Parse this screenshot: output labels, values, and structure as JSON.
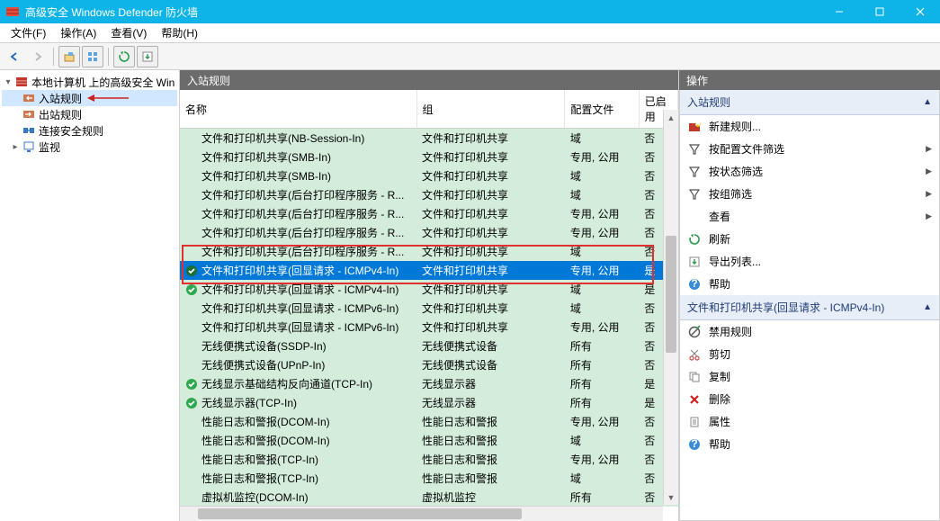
{
  "window": {
    "title": "高级安全 Windows Defender 防火墙"
  },
  "menu": {
    "file": "文件(F)",
    "operation": "操作(A)",
    "view": "查看(V)",
    "help": "帮助(H)"
  },
  "tree": {
    "root": "本地计算机 上的高级安全 Win",
    "inbound": "入站规则",
    "outbound": "出站规则",
    "connsec": "连接安全规则",
    "monitor": "监视"
  },
  "rules_panel": {
    "title": "入站规则",
    "columns": {
      "name": "名称",
      "group": "组",
      "profile": "配置文件",
      "enabled": "已启用"
    },
    "rows": [
      {
        "name": "文件和打印机共享(NB-Session-In)",
        "group": "文件和打印机共享",
        "profile": "域",
        "enabled": "否",
        "icon": ""
      },
      {
        "name": "文件和打印机共享(SMB-In)",
        "group": "文件和打印机共享",
        "profile": "专用, 公用",
        "enabled": "否",
        "icon": ""
      },
      {
        "name": "文件和打印机共享(SMB-In)",
        "group": "文件和打印机共享",
        "profile": "域",
        "enabled": "否",
        "icon": ""
      },
      {
        "name": "文件和打印机共享(后台打印程序服务 - R...",
        "group": "文件和打印机共享",
        "profile": "域",
        "enabled": "否",
        "icon": ""
      },
      {
        "name": "文件和打印机共享(后台打印程序服务 - R...",
        "group": "文件和打印机共享",
        "profile": "专用, 公用",
        "enabled": "否",
        "icon": ""
      },
      {
        "name": "文件和打印机共享(后台打印程序服务 - R...",
        "group": "文件和打印机共享",
        "profile": "专用, 公用",
        "enabled": "否",
        "icon": ""
      },
      {
        "name": "文件和打印机共享(后台打印程序服务 - R...",
        "group": "文件和打印机共享",
        "profile": "域",
        "enabled": "否",
        "icon": ""
      },
      {
        "name": "文件和打印机共享(回显请求 - ICMPv4-In)",
        "group": "文件和打印机共享",
        "profile": "专用, 公用",
        "enabled": "是",
        "icon": "allow-sel",
        "sel": true
      },
      {
        "name": "文件和打印机共享(回显请求 - ICMPv4-In)",
        "group": "文件和打印机共享",
        "profile": "域",
        "enabled": "是",
        "icon": "allow"
      },
      {
        "name": "文件和打印机共享(回显请求 - ICMPv6-In)",
        "group": "文件和打印机共享",
        "profile": "域",
        "enabled": "否",
        "icon": ""
      },
      {
        "name": "文件和打印机共享(回显请求 - ICMPv6-In)",
        "group": "文件和打印机共享",
        "profile": "专用, 公用",
        "enabled": "否",
        "icon": ""
      },
      {
        "name": "无线便携式设备(SSDP-In)",
        "group": "无线便携式设备",
        "profile": "所有",
        "enabled": "否",
        "icon": ""
      },
      {
        "name": "无线便携式设备(UPnP-In)",
        "group": "无线便携式设备",
        "profile": "所有",
        "enabled": "否",
        "icon": ""
      },
      {
        "name": "无线显示基础结构反向通道(TCP-In)",
        "group": "无线显示器",
        "profile": "所有",
        "enabled": "是",
        "icon": "allow"
      },
      {
        "name": "无线显示器(TCP-In)",
        "group": "无线显示器",
        "profile": "所有",
        "enabled": "是",
        "icon": "allow"
      },
      {
        "name": "性能日志和警报(DCOM-In)",
        "group": "性能日志和警报",
        "profile": "专用, 公用",
        "enabled": "否",
        "icon": ""
      },
      {
        "name": "性能日志和警报(DCOM-In)",
        "group": "性能日志和警报",
        "profile": "域",
        "enabled": "否",
        "icon": ""
      },
      {
        "name": "性能日志和警报(TCP-In)",
        "group": "性能日志和警报",
        "profile": "专用, 公用",
        "enabled": "否",
        "icon": ""
      },
      {
        "name": "性能日志和警报(TCP-In)",
        "group": "性能日志和警报",
        "profile": "域",
        "enabled": "否",
        "icon": ""
      },
      {
        "name": "虚拟机监控(DCOM-In)",
        "group": "虚拟机监控",
        "profile": "所有",
        "enabled": "否",
        "icon": ""
      }
    ]
  },
  "actions_panel": {
    "title": "操作",
    "section1": "入站规则",
    "new_rule": "新建规则...",
    "filter_profile": "按配置文件筛选",
    "filter_state": "按状态筛选",
    "filter_group": "按组筛选",
    "view": "查看",
    "refresh": "刷新",
    "export": "导出列表...",
    "help1": "帮助",
    "section2": "文件和打印机共享(回显请求 - ICMPv4-In)",
    "disable": "禁用规则",
    "cut": "剪切",
    "copy": "复制",
    "delete": "删除",
    "properties": "属性",
    "help2": "帮助"
  }
}
